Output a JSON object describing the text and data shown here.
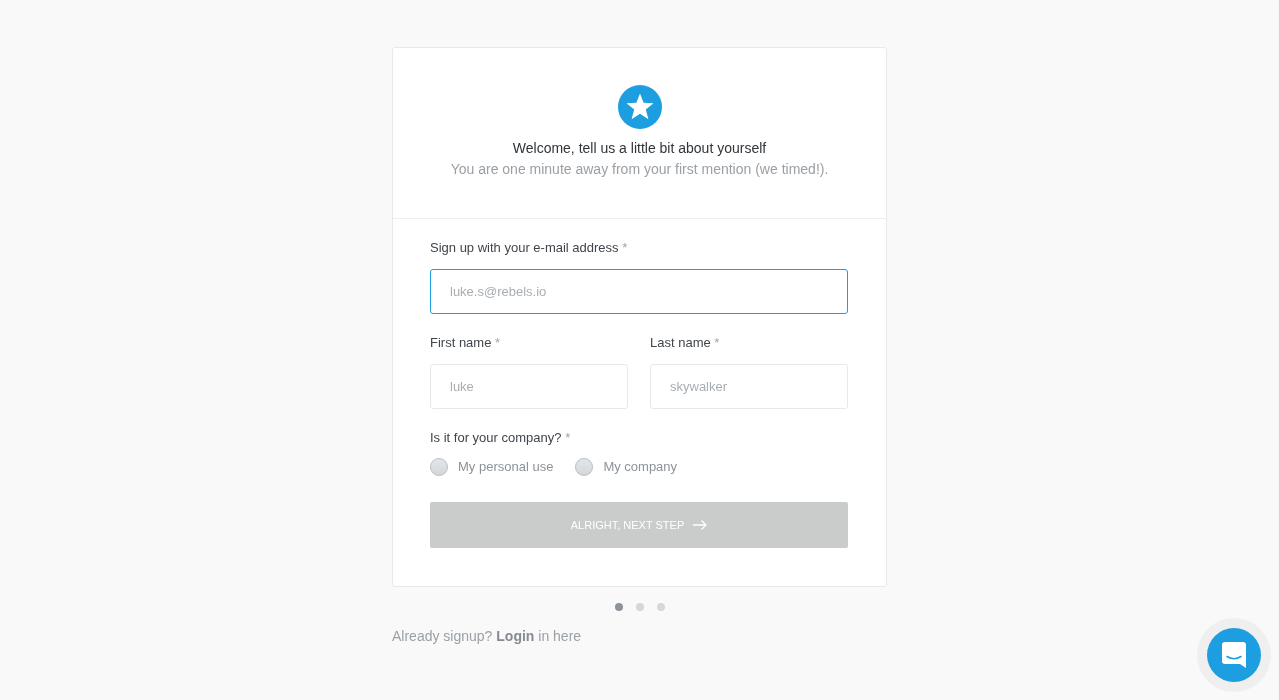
{
  "header": {
    "title": "Welcome, tell us a little bit about yourself",
    "subtitle": "You are one minute away from your first mention (we timed!)."
  },
  "email": {
    "label": "Sign up with your e-mail address",
    "required_mark": "*",
    "placeholder": "luke.s@rebels.io",
    "focused": true
  },
  "names": [
    {
      "label": "First name",
      "required_mark": "*",
      "placeholder": "luke",
      "focused": false
    },
    {
      "label": "Last name",
      "required_mark": "*",
      "placeholder": "skywalker",
      "focused": false
    }
  ],
  "usage": {
    "label": "Is it for your company?",
    "required_mark": "*",
    "options": [
      {
        "label": "My personal use",
        "selected": false
      },
      {
        "label": "My company",
        "selected": false
      }
    ]
  },
  "next_button": {
    "label": "ALRIGHT, NEXT STEP",
    "disabled": true
  },
  "steps": [
    {
      "selected": true
    },
    {
      "selected": false
    },
    {
      "selected": false
    }
  ],
  "footer": {
    "before": "Already signup?",
    "link": "Login",
    "after": "in here"
  }
}
